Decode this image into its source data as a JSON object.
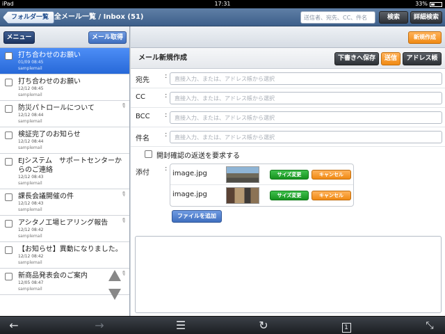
{
  "statusbar": {
    "device": "iPad",
    "time": "17:31",
    "battery": "33%",
    "battery_level": 0.33
  },
  "topnav": {
    "back_label": "フォルダ一覧",
    "title": "全メール一覧 / Inbox (51)",
    "search_placeholder": "送信者、宛先、CC、件名",
    "search_label": "検索",
    "advanced_search_label": "詳細検索"
  },
  "left": {
    "menu_label": "メニュー",
    "fetch_label": "メール取得",
    "mails": [
      {
        "subject": "打ち合わせのお願い",
        "date": "01/09 08:45",
        "sender": "samplemail",
        "selected": true,
        "attachment": false
      },
      {
        "subject": "打ち合わせのお願い",
        "date": "12/12 08:45",
        "sender": "samplemail",
        "selected": false,
        "attachment": false
      },
      {
        "subject": "防災パトロールについて",
        "date": "12/12 08:44",
        "sender": "samplemail",
        "selected": false,
        "attachment": true
      },
      {
        "subject": "検証完了のお知らせ",
        "date": "12/12 08:44",
        "sender": "samplemail",
        "selected": false,
        "attachment": false
      },
      {
        "subject": "EJシステム　サポートセンターからのご連絡",
        "date": "12/12 08:43",
        "sender": "samplemail",
        "selected": false,
        "attachment": false
      },
      {
        "subject": "課長会議開催の件",
        "date": "12/12 08:43",
        "sender": "samplemail",
        "selected": false,
        "attachment": true
      },
      {
        "subject": "アシタノ工場ヒアリング報告",
        "date": "12/12 08:42",
        "sender": "samplemail",
        "selected": false,
        "attachment": true
      },
      {
        "subject": "【お知らせ】異動になりました。",
        "date": "12/12 08:42",
        "sender": "samplemail",
        "selected": false,
        "attachment": false
      },
      {
        "subject": "新商品発表会のご案内",
        "date": "12/05 08:47",
        "sender": "samplemail",
        "selected": false,
        "attachment": true
      }
    ]
  },
  "right": {
    "new_mail_label": "新規作成",
    "compose": {
      "title": "メール新規作成",
      "save_draft_label": "下書きへ保存",
      "send_label": "送信",
      "address_book_label": "アドレス帳",
      "fields": [
        {
          "label": "宛先",
          "placeholder": "直接入力、または、アドレス帳から選択"
        },
        {
          "label": "CC",
          "placeholder": "直接入力、または、アドレス帳から選択"
        },
        {
          "label": "BCC",
          "placeholder": "直接入力、または、アドレス帳から選択"
        },
        {
          "label": "件名",
          "placeholder": "直接入力、または、アドレス帳から選択"
        }
      ],
      "colon": ":",
      "receipt_label": "開封確認の返送を要求する",
      "attach_label": "添付",
      "attachments": [
        {
          "name": "image.jpg",
          "resize_label": "サイズ変更",
          "cancel_label": "キャンセル"
        },
        {
          "name": "image.jpg",
          "resize_label": "サイズ変更",
          "cancel_label": "キャンセル"
        }
      ],
      "add_file_label": "ファイルを追加"
    }
  },
  "bottombar": {
    "back_icon": "←",
    "forward_icon": "→",
    "menu_icon": "☰",
    "reload_icon": "↻",
    "tabs_count": "1",
    "fullscreen_icon": "⤡"
  },
  "colors": {
    "accent_blue": "#2769d8",
    "orange": "#f08a14",
    "green": "#16921f",
    "dark": "#2d3136"
  }
}
